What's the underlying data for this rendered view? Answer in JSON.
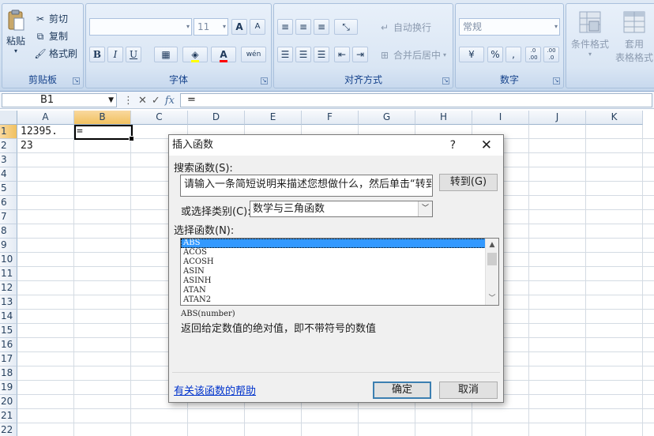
{
  "ribbon": {
    "clipboard": {
      "label": "剪贴板",
      "paste": "粘贴",
      "cut": "剪切",
      "copy": "复制",
      "format_painter": "格式刷"
    },
    "font": {
      "label": "字体",
      "font_name": "",
      "font_size": "11",
      "grow": "A",
      "shrink": "A",
      "bold": "B",
      "italic": "I",
      "underline": "U",
      "phonetic": "wén"
    },
    "alignment": {
      "label": "对齐方式",
      "wrap_text": "自动换行",
      "merge_center": "合并后居中"
    },
    "number": {
      "label": "数字",
      "format": "常规",
      "percent": "%",
      "comma": ",",
      "inc_decimal": ".0 .00",
      "dec_decimal": ".00 .0"
    },
    "styles": {
      "conditional_format": "条件格式",
      "table_format_1": "套用",
      "table_format_2": "表格格式"
    }
  },
  "formula_bar": {
    "name_box": "B1",
    "cancel": "✕",
    "enter": "✓",
    "fx": "fx",
    "content": "="
  },
  "sheet": {
    "columns": [
      "A",
      "B",
      "C",
      "D",
      "E",
      "F",
      "G",
      "H",
      "I",
      "J",
      "K"
    ],
    "selected_column": "B",
    "rows": [
      "1",
      "2",
      "3",
      "4",
      "5",
      "6",
      "7",
      "8",
      "9",
      "10",
      "11",
      "12",
      "13",
      "14",
      "15",
      "16",
      "17",
      "18",
      "19",
      "20",
      "21",
      "22"
    ],
    "selected_row": "1",
    "cells": {
      "A1": "12395. 23",
      "B1": "="
    }
  },
  "dialog": {
    "title": "插入函数",
    "help": "?",
    "close": "✕",
    "search_label": "搜索函数(S):",
    "search_value": "请输入一条简短说明来描述您想做什么，然后单击“转到”",
    "go_button": "转到(G)",
    "category_label": "或选择类别(C):",
    "category_value": "数学与三角函数",
    "function_label": "选择函数(N):",
    "functions": [
      "ABS",
      "ACOS",
      "ACOSH",
      "ASIN",
      "ASINH",
      "ATAN",
      "ATAN2"
    ],
    "selected_function": "ABS",
    "syntax": "ABS(number)",
    "description": "返回给定数值的绝对值，即不带符号的数值",
    "help_link": "有关该函数的帮助",
    "ok": "确定",
    "cancel": "取消"
  }
}
